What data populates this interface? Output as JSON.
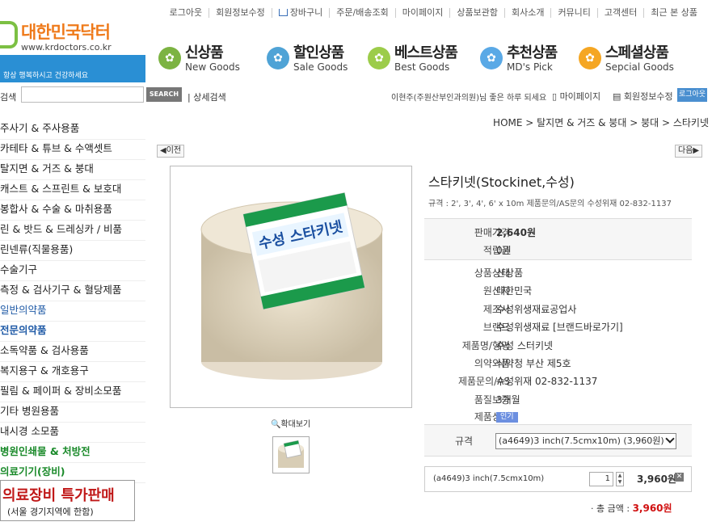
{
  "topnav": [
    "로그아웃",
    "회원정보수정",
    "장바구니",
    "주문/배송조회",
    "마이페이지",
    "상품보관함",
    "회사소개",
    "커뮤니티",
    "고객센터",
    "최근 본 상품"
  ],
  "logo": {
    "name": "대한민국닥터",
    "url": "www.krdoctors.co.kr"
  },
  "bluebar_text": "항상 행복하시고 건강하세요",
  "tabs": [
    {
      "k": "신상품",
      "e": "New Goods",
      "color": "#7cb342"
    },
    {
      "k": "할인상품",
      "e": "Sale Goods",
      "color": "#4fa3d6"
    },
    {
      "k": "베스트상품",
      "e": "Best Goods",
      "color": "#9ccc4a"
    },
    {
      "k": "추천상품",
      "e": "MD's Pick",
      "color": "#5aa9e6"
    },
    {
      "k": "스페셜상품",
      "e": "Sepcial Goods",
      "color": "#f5a623"
    }
  ],
  "search": {
    "label": "검색",
    "button": "SEARCH",
    "advanced": "상세검색",
    "greeting": "이현주(주원산부인과의원)님 좋은 하루 되세요",
    "mypage": "마이페이지",
    "member_edit": "회원정보수정",
    "logout": "로그아웃"
  },
  "sidebar": [
    {
      "label": "주사기 & 주사용품",
      "style": ""
    },
    {
      "label": "카테타 & 튜브 & 수액셋트",
      "style": ""
    },
    {
      "label": "탈지면 & 거즈 & 붕대",
      "style": ""
    },
    {
      "label": "캐스트 & 스프린트 & 보호대",
      "style": ""
    },
    {
      "label": "봉합사 & 수술 & 마취용품",
      "style": ""
    },
    {
      "label": "린 & 밧드 & 드레싱카 / 비품",
      "style": ""
    },
    {
      "label": "린넨류(직물용품)",
      "style": ""
    },
    {
      "label": "수술기구",
      "style": ""
    },
    {
      "label": "측정 & 검사기구 & 혈당제품",
      "style": ""
    },
    {
      "label": "일반의약품",
      "style": "blue"
    },
    {
      "label": "전문의약품",
      "style": "blue bold"
    },
    {
      "label": "소독약품 & 검사용품",
      "style": ""
    },
    {
      "label": "복지용구 & 개호용구",
      "style": ""
    },
    {
      "label": "필림 & 페이퍼 & 장비소모품",
      "style": ""
    },
    {
      "label": "기타 병원용품",
      "style": ""
    },
    {
      "label": "내시경 소모품",
      "style": ""
    },
    {
      "label": "병원인쇄물 & 처방전",
      "style": "green"
    },
    {
      "label": "의료기기(장비)",
      "style": "green"
    }
  ],
  "promo": {
    "line1": "의료장비 특가판매",
    "line2": "(서울 경기지역에 한함)"
  },
  "breadcrumb": "HOME > 탈지면 & 거즈 & 붕대 > 붕대 > 스타키넷",
  "prev": "이전",
  "next": "다음",
  "product": {
    "title": "스타키넷(Stockinet,수성)",
    "spec": "규격 : 2', 3', 4', 6' x 10m 제품문의/AS문의 수성위재 02-832-1137",
    "package_label": "수성 스타키넷",
    "zoom": "확대보기",
    "price_label": "판매가격",
    "price": "2,640원",
    "points_label": "적립금",
    "points": "0원",
    "info": [
      {
        "k": "상품상태",
        "v": "신상품"
      },
      {
        "k": "원산지",
        "v": "대한민국"
      },
      {
        "k": "제조사",
        "v": "수성위생재료공업사"
      },
      {
        "k": "브랜드",
        "v": "수성위생재료 [브랜드바로가기]"
      },
      {
        "k": "제품명/형명",
        "v": "수성 스터키넷"
      },
      {
        "k": "의약외품",
        "v": "식약청 부산 제5호"
      },
      {
        "k": "제품문의/AS",
        "v": "수성위재 02-832-1137"
      },
      {
        "k": "품질보증",
        "v": "3개월"
      }
    ],
    "status_label": "제품상태",
    "status_badge": "인기",
    "option_label": "규격",
    "option_value": "(a4649)3 inch(7.5cmx10m) (3,960원)",
    "selected": {
      "name": "(a4649)3 inch(7.5cmx10m)",
      "qty": "1",
      "price": "3,960원"
    },
    "total_label": "· 총 금액 :",
    "total": "3,960원"
  }
}
